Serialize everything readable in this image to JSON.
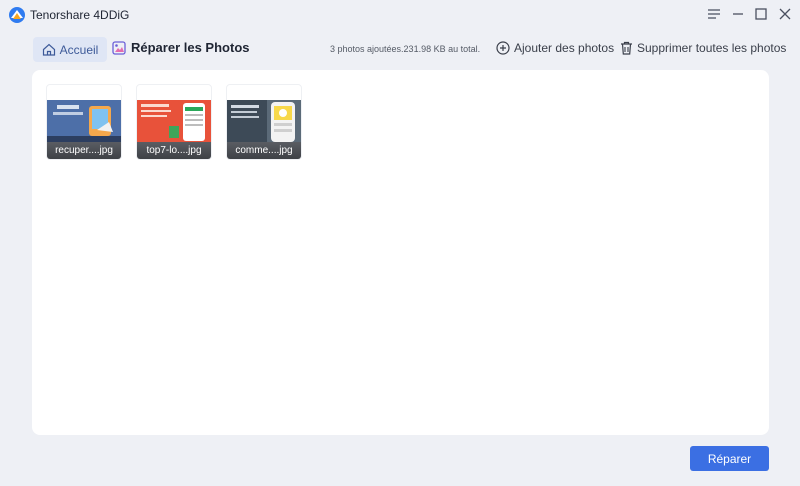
{
  "app": {
    "title": "Tenorshare 4DDiG",
    "accent": "#3b6fe3"
  },
  "window_controls": [
    "menu-icon",
    "minimize-icon",
    "maximize-icon",
    "close-icon"
  ],
  "toolbar": {
    "home_label": "Accueil",
    "section_title": "Réparer les Photos",
    "summary": "3 photos ajoutées.231.98 KB au total.",
    "add_label": "Ajouter des photos",
    "delete_all_label": "Supprimer toutes les photos"
  },
  "photos": [
    {
      "name": "recuper....jpg"
    },
    {
      "name": "top7-lo....jpg"
    },
    {
      "name": "comme....jpg"
    }
  ],
  "footer": {
    "repair_label": "Réparer"
  }
}
